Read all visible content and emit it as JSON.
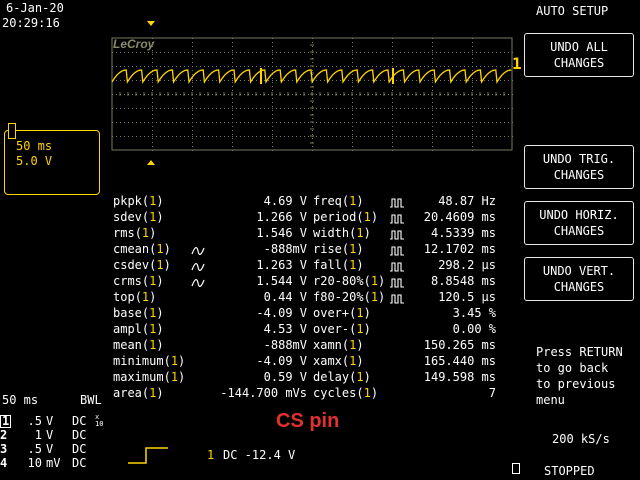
{
  "header": {
    "date": "6-Jan-20",
    "time": "20:29:16",
    "mode": "AUTO SETUP"
  },
  "screen": {
    "brand": "LeCroy",
    "trace_marker": "1"
  },
  "menu": {
    "buttons": [
      {
        "line1": "UNDO ALL",
        "line2": "CHANGES"
      },
      {
        "line1": "UNDO TRIG.",
        "line2": "CHANGES"
      },
      {
        "line1": "UNDO HORIZ.",
        "line2": "CHANGES"
      },
      {
        "line1": "UNDO VERT.",
        "line2": "CHANGES"
      }
    ],
    "help": [
      "Press RETURN",
      "to go back",
      "to previous",
      "menu"
    ],
    "sample_rate": "200 kS/s",
    "status": "STOPPED"
  },
  "timebase_box": {
    "time": "50 ms",
    "volts": "5.0 V"
  },
  "measurements": {
    "left": [
      {
        "name": "pkpk",
        "ch": "1",
        "value": "4.69 V"
      },
      {
        "name": "sdev",
        "ch": "1",
        "value": "1.266 V"
      },
      {
        "name": "rms",
        "ch": "1",
        "value": "1.546 V"
      },
      {
        "name": "cmean",
        "ch": "1",
        "value": "-888mV"
      },
      {
        "name": "csdev",
        "ch": "1",
        "value": "1.263 V"
      },
      {
        "name": "crms",
        "ch": "1",
        "value": "1.544 V"
      },
      {
        "name": "top",
        "ch": "1",
        "value": "0.44 V"
      },
      {
        "name": "base",
        "ch": "1",
        "value": "-4.09 V"
      },
      {
        "name": "ampl",
        "ch": "1",
        "value": "4.53 V"
      },
      {
        "name": "mean",
        "ch": "1",
        "value": "-888mV"
      },
      {
        "name": "minimum",
        "ch": "1",
        "value": "-4.09 V"
      },
      {
        "name": "maximum",
        "ch": "1",
        "value": "0.59 V"
      },
      {
        "name": "area",
        "ch": "1",
        "value": "-144.700 mVs"
      }
    ],
    "right": [
      {
        "name": "freq",
        "ch": "1",
        "value": "48.87 Hz"
      },
      {
        "name": "period",
        "ch": "1",
        "value": "20.4609 ms"
      },
      {
        "name": "width",
        "ch": "1",
        "value": "4.5339 ms"
      },
      {
        "name": "rise",
        "ch": "1",
        "value": "12.1702 ms"
      },
      {
        "name": "fall",
        "ch": "1",
        "value": "298.2 µs"
      },
      {
        "name": "r20-80%",
        "ch": "1",
        "value": "8.8548 ms"
      },
      {
        "name": "f80-20%",
        "ch": "1",
        "value": "120.5 µs"
      },
      {
        "name": "over+",
        "ch": "1",
        "value": "3.45 %"
      },
      {
        "name": "over-",
        "ch": "1",
        "value": "0.00 %"
      },
      {
        "name": "xamn",
        "ch": "1",
        "value": "150.265 ms"
      },
      {
        "name": "xamx",
        "ch": "1",
        "value": "165.440 ms"
      },
      {
        "name": "delay",
        "ch": "1",
        "value": "149.598 ms"
      },
      {
        "name": "cycles",
        "ch": "1",
        "value": "7"
      }
    ]
  },
  "channels": {
    "timebase": "50 ms",
    "bwl": "BWL",
    "rows": [
      {
        "num": "1",
        "scale": ".5",
        "unit": "V",
        "coupling": "DC"
      },
      {
        "num": "2",
        "scale": "1",
        "unit": "V",
        "coupling": "DC"
      },
      {
        "num": "3",
        "scale": ".5",
        "unit": "V",
        "coupling": "DC"
      },
      {
        "num": "4",
        "scale": "10",
        "unit": "mV",
        "coupling": "DC"
      }
    ]
  },
  "trigger": {
    "channel": "1",
    "text": "DC -12.4 V"
  },
  "annotation": {
    "text": "CS pin",
    "color": "#e03030"
  },
  "colors": {
    "trace": "#ffd400",
    "grid": "#7a7a5a",
    "text": "#ffffff"
  }
}
